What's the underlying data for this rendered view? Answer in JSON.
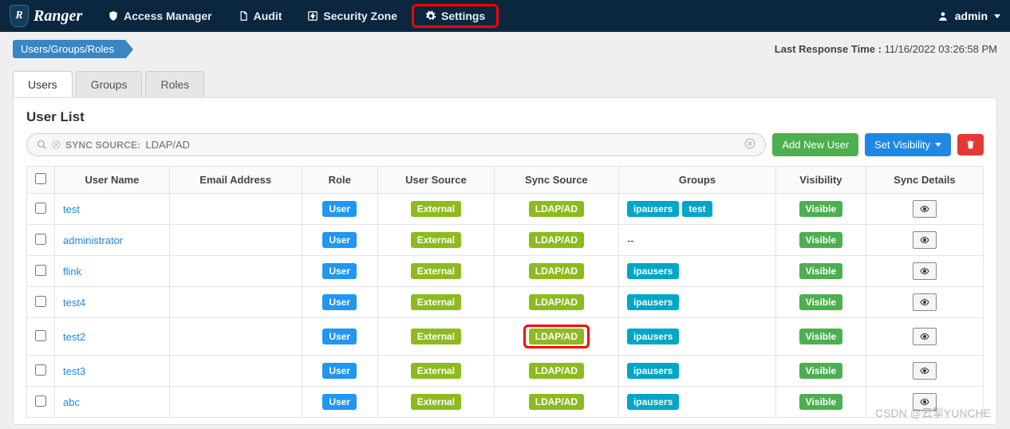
{
  "brand": {
    "name": "Ranger",
    "badge_letter": "R"
  },
  "nav": {
    "items": [
      {
        "label": "Access Manager",
        "icon": "shield-icon"
      },
      {
        "label": "Audit",
        "icon": "document-icon"
      },
      {
        "label": "Security Zone",
        "icon": "bolt-box-icon"
      },
      {
        "label": "Settings",
        "icon": "gear-icon",
        "highlight": true
      }
    ],
    "user": {
      "label": "admin",
      "icon": "user-icon"
    }
  },
  "breadcrumb": {
    "label": "Users/Groups/Roles"
  },
  "last_response": {
    "prefix": "Last Response Time :",
    "value": "11/16/2022 03:26:58 PM"
  },
  "tabs": [
    {
      "label": "Users",
      "active": true
    },
    {
      "label": "Groups",
      "active": false
    },
    {
      "label": "Roles",
      "active": false
    }
  ],
  "panel": {
    "title": "User List",
    "search": {
      "tag_label": "SYNC SOURCE:",
      "tag_value": "LDAP/AD"
    },
    "buttons": {
      "add": "Add New User",
      "visibility": "Set Visibility"
    }
  },
  "table": {
    "headers": [
      "",
      "User Name",
      "Email Address",
      "Role",
      "User Source",
      "Sync Source",
      "Groups",
      "Visibility",
      "Sync Details"
    ],
    "rows": [
      {
        "user": "test",
        "email": "",
        "role": "User",
        "source": "External",
        "sync": "LDAP/AD",
        "groups": [
          "ipausers",
          "test"
        ],
        "visibility": "Visible",
        "sync_highlight": false
      },
      {
        "user": "administrator",
        "email": "",
        "role": "User",
        "source": "External",
        "sync": "LDAP/AD",
        "groups_text": "--",
        "visibility": "Visible",
        "sync_highlight": false
      },
      {
        "user": "flink",
        "email": "",
        "role": "User",
        "source": "External",
        "sync": "LDAP/AD",
        "groups": [
          "ipausers"
        ],
        "visibility": "Visible",
        "sync_highlight": false
      },
      {
        "user": "test4",
        "email": "",
        "role": "User",
        "source": "External",
        "sync": "LDAP/AD",
        "groups": [
          "ipausers"
        ],
        "visibility": "Visible",
        "sync_highlight": false
      },
      {
        "user": "test2",
        "email": "",
        "role": "User",
        "source": "External",
        "sync": "LDAP/AD",
        "groups": [
          "ipausers"
        ],
        "visibility": "Visible",
        "sync_highlight": true
      },
      {
        "user": "test3",
        "email": "",
        "role": "User",
        "source": "External",
        "sync": "LDAP/AD",
        "groups": [
          "ipausers"
        ],
        "visibility": "Visible",
        "sync_highlight": false
      },
      {
        "user": "abc",
        "email": "",
        "role": "User",
        "source": "External",
        "sync": "LDAP/AD",
        "groups": [
          "ipausers"
        ],
        "visibility": "Visible",
        "sync_highlight": false
      }
    ]
  },
  "watermark": "CSDN @云掣YUNCHE"
}
